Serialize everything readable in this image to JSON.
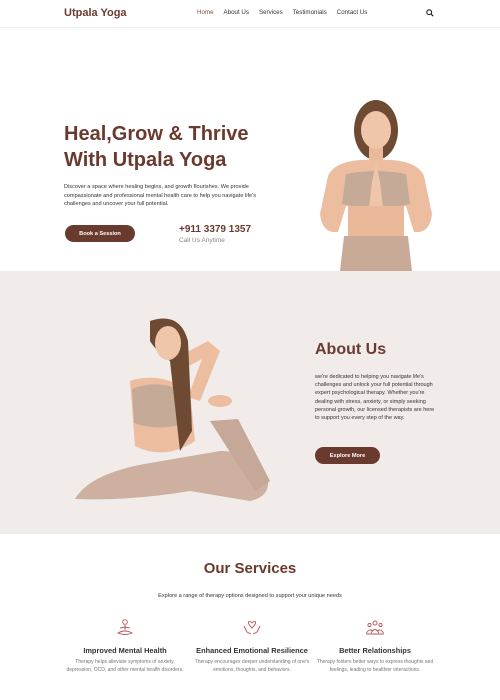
{
  "header": {
    "logo": "Utpala Yoga",
    "nav": [
      {
        "label": "Home"
      },
      {
        "label": "About Us"
      },
      {
        "label": "Services"
      },
      {
        "label": "Testimonials"
      },
      {
        "label": "Contact Us"
      }
    ],
    "search_icon": "search-icon"
  },
  "hero": {
    "title_line1": "Heal,Grow & Thrive",
    "title_line2": "With Utpala Yoga",
    "description": "Discover a space where healing begins, and growth flourishes. We provide compassionate and professional mental health care to help you navigate life's challenges and uncover your full potential.",
    "button": "Book a Session",
    "phone": "+911 3379 1357",
    "call_label": "Call Us Anytime"
  },
  "about": {
    "title": "About Us",
    "description": "we're dedicated to helping you navigate life's challenges and unlock your full potential through expert psychological therapy. Whether you're dealing with stress, anxiety, or simply seeking personal growth, our licensed therapists are here to support you every step of the way.",
    "button": "Explore More"
  },
  "services": {
    "title": "Our Services",
    "subtitle": "Explore a range of therapy options designed to support your unique needs",
    "items": [
      {
        "title": "Improved Mental Health",
        "description": "Therapy helps alleviate symptoms of anxiety, depression, OCD, and other mental health disorders.",
        "icon": "meditation-icon"
      },
      {
        "title": "Enhanced Emotional Resilience",
        "description": "Therapy encourages deeper understanding of one's emotions, thoughts, and behaviors.",
        "icon": "heart-hands-icon"
      },
      {
        "title": "Better Relationships",
        "description": "Therapy fosters better ways to express thoughts and feelings, leading to healthier interactions.",
        "icon": "group-icon"
      }
    ]
  },
  "colors": {
    "brand": "#6b3a2e",
    "about_bg": "#f1ecea",
    "icon_accent": "#b5535a"
  }
}
